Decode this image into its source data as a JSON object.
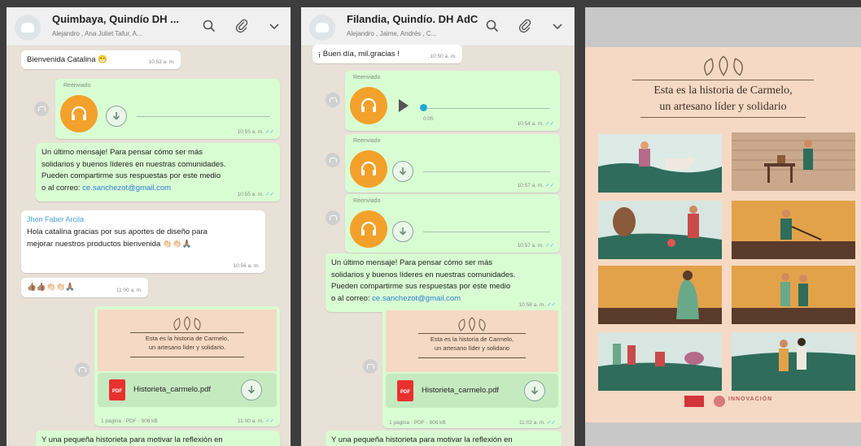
{
  "chat1": {
    "title": "Quimbaya, Quindío DH ...",
    "subtitle": "Alejandro , Ana Juliet Tafur, A...",
    "welcome": {
      "text": "Bienvenida Catalina 😁",
      "time": "10:53 a. m."
    },
    "audio": {
      "forwarded": "Reenviado",
      "time": "10:55 a. m."
    },
    "text_msg": {
      "lines": [
        "Un último mensaje! Para pensar cómo ser más",
        "solidarios y buenos líderes en nuestras comunidades.",
        "Pueden compartirme sus respuestas por este medio"
      ],
      "prefix": "o al correo: ",
      "email": "ce.sanchezot@gmail.com",
      "time": "10:55 a. m."
    },
    "reply": {
      "sender": "Jhon Faber Arcila",
      "lines": [
        "Hola catalina gracias por sus aportes de diseño para",
        "mejorar nuestros productos bienvenida 👏🏻👏🏻🙏🏽"
      ],
      "time": "10:56 a. m."
    },
    "emoji_msg": {
      "text": "👍🏽👍🏽👏🏻👏🏻🙏🏽",
      "time": "11:00 a. m."
    },
    "pdf": {
      "thumb_title": [
        "Esta es la historia de Carmelo,",
        "un artesano líder y solidario."
      ],
      "file_name": "Historieta_carmelo.pdf",
      "meta": "1 página · PDF · 906 kB",
      "time": "11:00 a. m."
    },
    "bottom_text": "Y una pequeña historieta para motivar la reflexión en"
  },
  "chat2": {
    "title": "Filandia, Quindío. DH AdC",
    "subtitle": "Alejandro , Jaime, Andrés , C...",
    "greeting": {
      "text": "¡ Buen día, mil.gracias !",
      "time": "10:50 a. m."
    },
    "audio1": {
      "forwarded": "Reenviado",
      "duration": "0:05",
      "time": "10:54 a. m."
    },
    "audio2": {
      "forwarded": "Reenviado",
      "time": "10:57 a. m."
    },
    "audio3": {
      "forwarded": "Reenviado",
      "time": "10:57 a. m."
    },
    "text_msg": {
      "lines": [
        "Un último mensaje! Para pensar cómo ser más",
        "solidarios y buenos líderes en nuestras comunidades.",
        "Pueden compartirme sus respuestas por este medio"
      ],
      "prefix": "o al correo: ",
      "email": "ce.sanchezot@gmail.com",
      "time": "10:58 a. m."
    },
    "pdf": {
      "thumb_title": [
        "Esta es la historia de Carmelo,",
        "un artesano líder y solidario"
      ],
      "file_name": "Historieta_carmelo.pdf",
      "meta": "1 página · PDF · 906 kB",
      "time": "11:02 a. m."
    },
    "bottom_text": "Y una pequeña historieta para motivar la reflexión en"
  },
  "poster": {
    "title_line1": "Esta es la historia de Carmelo,",
    "title_line2": "un artesano líder y solidario",
    "logo_text": "INNOVACIÓN"
  },
  "colors": {
    "chat_bg": "#e8e1d8",
    "outgoing": "#d9fdd3",
    "incoming": "#ffffff",
    "accent_orange": "#f3a12a",
    "link": "#2c7ed6",
    "pdf_red": "#e8312f",
    "poster_bg": "#f5d9c4"
  },
  "icons": [
    "search-icon",
    "attach-icon",
    "chevron-down-icon",
    "headphones-icon",
    "download-icon",
    "play-icon",
    "forward-icon",
    "pdf-icon"
  ]
}
